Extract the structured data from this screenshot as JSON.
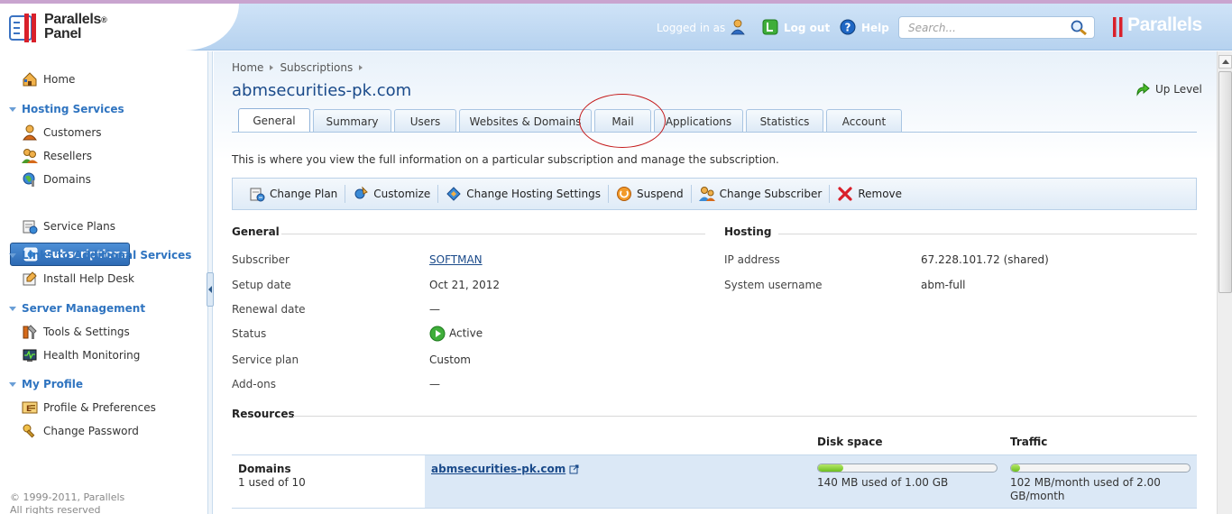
{
  "header": {
    "logo_line1": "Parallels",
    "logo_reg": "®",
    "logo_line2": "Panel",
    "logged_in_as": "Logged in as",
    "logout": "Log out",
    "help": "Help",
    "search_placeholder": "Search...",
    "brand": "Parallels"
  },
  "sidebar": {
    "home": "Home",
    "hosting_services": "Hosting Services",
    "customers": "Customers",
    "resellers": "Resellers",
    "domains": "Domains",
    "subscriptions": "Subscriptions",
    "service_plans": "Service Plans",
    "links_additional": "Links to Additional Services",
    "install_help_desk": "Install Help Desk",
    "server_management": "Server Management",
    "tools_settings": "Tools & Settings",
    "health_monitoring": "Health Monitoring",
    "my_profile": "My Profile",
    "profile_preferences": "Profile & Preferences",
    "change_password": "Change Password",
    "copyright_1": "© 1999-2011, Parallels",
    "copyright_2": "All rights reserved"
  },
  "main": {
    "breadcrumb_home": "Home",
    "breadcrumb_subs": "Subscriptions",
    "title": "abmsecurities-pk.com",
    "up_level": "Up Level",
    "tabs": [
      "General",
      "Summary",
      "Users",
      "Websites & Domains",
      "Mail",
      "Applications",
      "Statistics",
      "Account"
    ],
    "description": "This is where you view the full information on a particular subscription and manage the subscription.",
    "toolbar": {
      "change_plan": "Change Plan",
      "customize": "Customize",
      "change_hosting": "Change Hosting Settings",
      "suspend": "Suspend",
      "change_subscriber": "Change Subscriber",
      "remove": "Remove"
    },
    "general": {
      "heading": "General",
      "subscriber_label": "Subscriber",
      "subscriber_value": "SOFTMAN",
      "setup_label": "Setup date",
      "setup_value": "Oct 21, 2012",
      "renewal_label": "Renewal date",
      "renewal_value": "—",
      "status_label": "Status",
      "status_value": "Active",
      "plan_label": "Service plan",
      "plan_value": "Custom",
      "addons_label": "Add-ons",
      "addons_value": "—"
    },
    "hosting": {
      "heading": "Hosting",
      "ip_label": "IP address",
      "ip_value": "67.228.101.72 (shared)",
      "user_label": "System username",
      "user_value": "abm-full"
    },
    "resources": {
      "heading": "Resources",
      "disk_header": "Disk space",
      "traffic_header": "Traffic",
      "domains_label": "Domains",
      "domains_used": "1 used of 10",
      "domain_link": "abmsecurities-pk.com",
      "disk_text": "140 MB used of 1.00 GB",
      "traffic_text_1": "102 MB/month used of 2.00",
      "traffic_text_2": "GB/month",
      "disk_fraction": 0.14,
      "traffic_fraction": 0.05
    }
  }
}
